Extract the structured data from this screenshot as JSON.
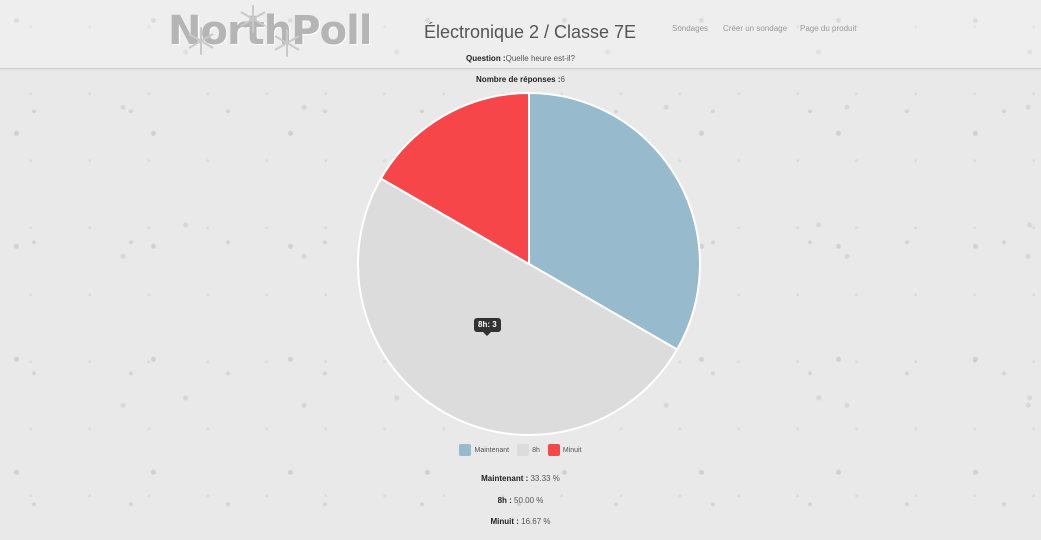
{
  "header": {
    "logo_text": "NorthPoll",
    "title": "Électronique 2 / Classe 7E",
    "nav": [
      {
        "label": "Sondages"
      },
      {
        "label": "Créer un sondage"
      },
      {
        "label": "Page du produit"
      }
    ]
  },
  "poll": {
    "question_label": "Question :",
    "question": "Quelle heure est-il?",
    "responses_label": "Nombre de réponses :",
    "responses": "6"
  },
  "tooltip": "8h: 3",
  "chart_data": {
    "type": "pie",
    "title": "",
    "slices": [
      {
        "label": "Maintenant",
        "value": 2,
        "color": "#97bbcd"
      },
      {
        "label": "8h",
        "value": 3,
        "color": "#dcdcdc"
      },
      {
        "label": "Minuit",
        "value": 1,
        "color": "#f7464a"
      }
    ],
    "legend": "bottom"
  },
  "stats": [
    {
      "label": "Maintenant :",
      "value": "33.33 %"
    },
    {
      "label": "8h :",
      "value": "50.00 %"
    },
    {
      "label": "Minuit :",
      "value": "16.67 %"
    }
  ],
  "colors": {
    "background": "#e9e9e9",
    "maintenant": "#97bbcd",
    "huit": "#dcdcdc",
    "minuit": "#f7464a"
  }
}
